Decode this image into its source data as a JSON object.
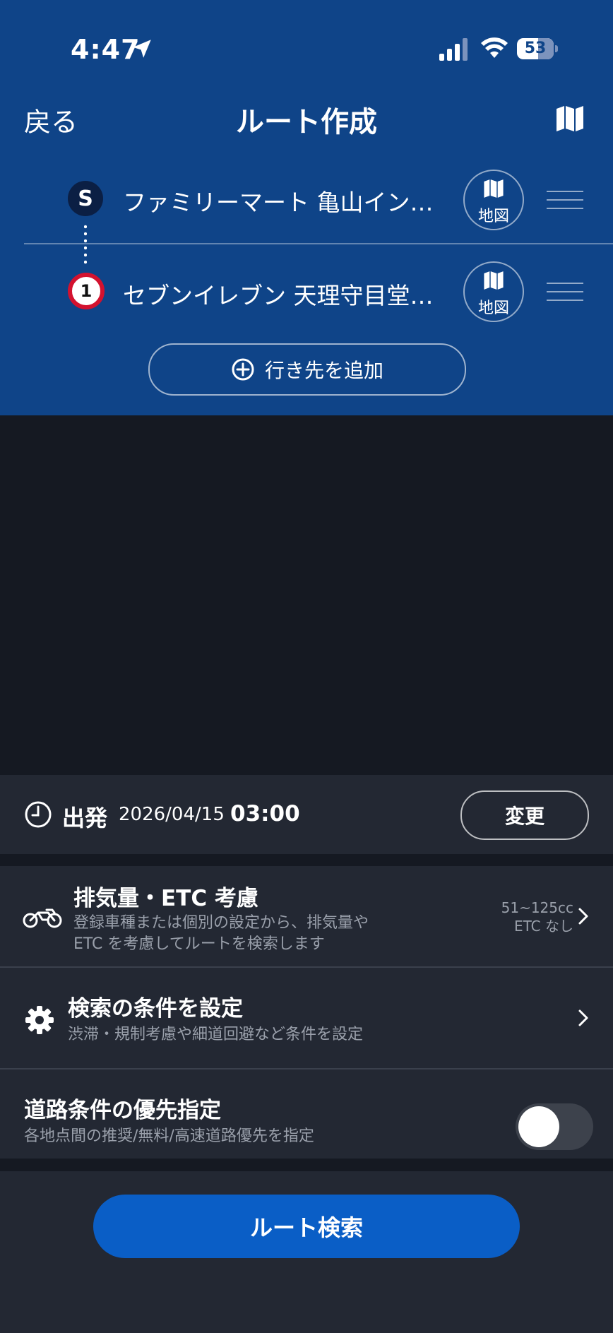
{
  "status_bar": {
    "time": "4:47",
    "battery": "53"
  },
  "header": {
    "back_label": "戻る",
    "title": "ルート作成"
  },
  "route": {
    "start": {
      "marker": "S",
      "name": "ファミリーマート 亀山イン…",
      "map_label": "地図"
    },
    "stop1": {
      "marker": "1",
      "name": "セブンイレブン 天理守目堂…",
      "map_label": "地図"
    },
    "add_destination_label": "行き先を追加"
  },
  "departure": {
    "label": "出発",
    "date": "2026/04/15",
    "time": "03:00",
    "change_label": "変更"
  },
  "settings": {
    "exhaust": {
      "title": "排気量・ETC 考慮",
      "desc_line1": "登録車種または個別の設定から、排気量や",
      "desc_line2": "ETC を考慮してルートを検索します",
      "value_line1": "51~125cc",
      "value_line2": "ETC なし"
    },
    "conditions": {
      "title": "検索の条件を設定",
      "desc": "渋滞・規制考慮や細道回避など条件を設定"
    },
    "road_priority": {
      "title": "道路条件の優先指定",
      "desc": "各地点間の推奨/無料/高速道路優先を指定",
      "enabled": false
    }
  },
  "search_button_label": "ルート検索",
  "colors": {
    "header_bg": "#0f4488",
    "body_bg": "#151922",
    "panel_bg": "#232833",
    "primary_button": "#0a5ec6",
    "stop_marker_ring": "#d3122f"
  }
}
